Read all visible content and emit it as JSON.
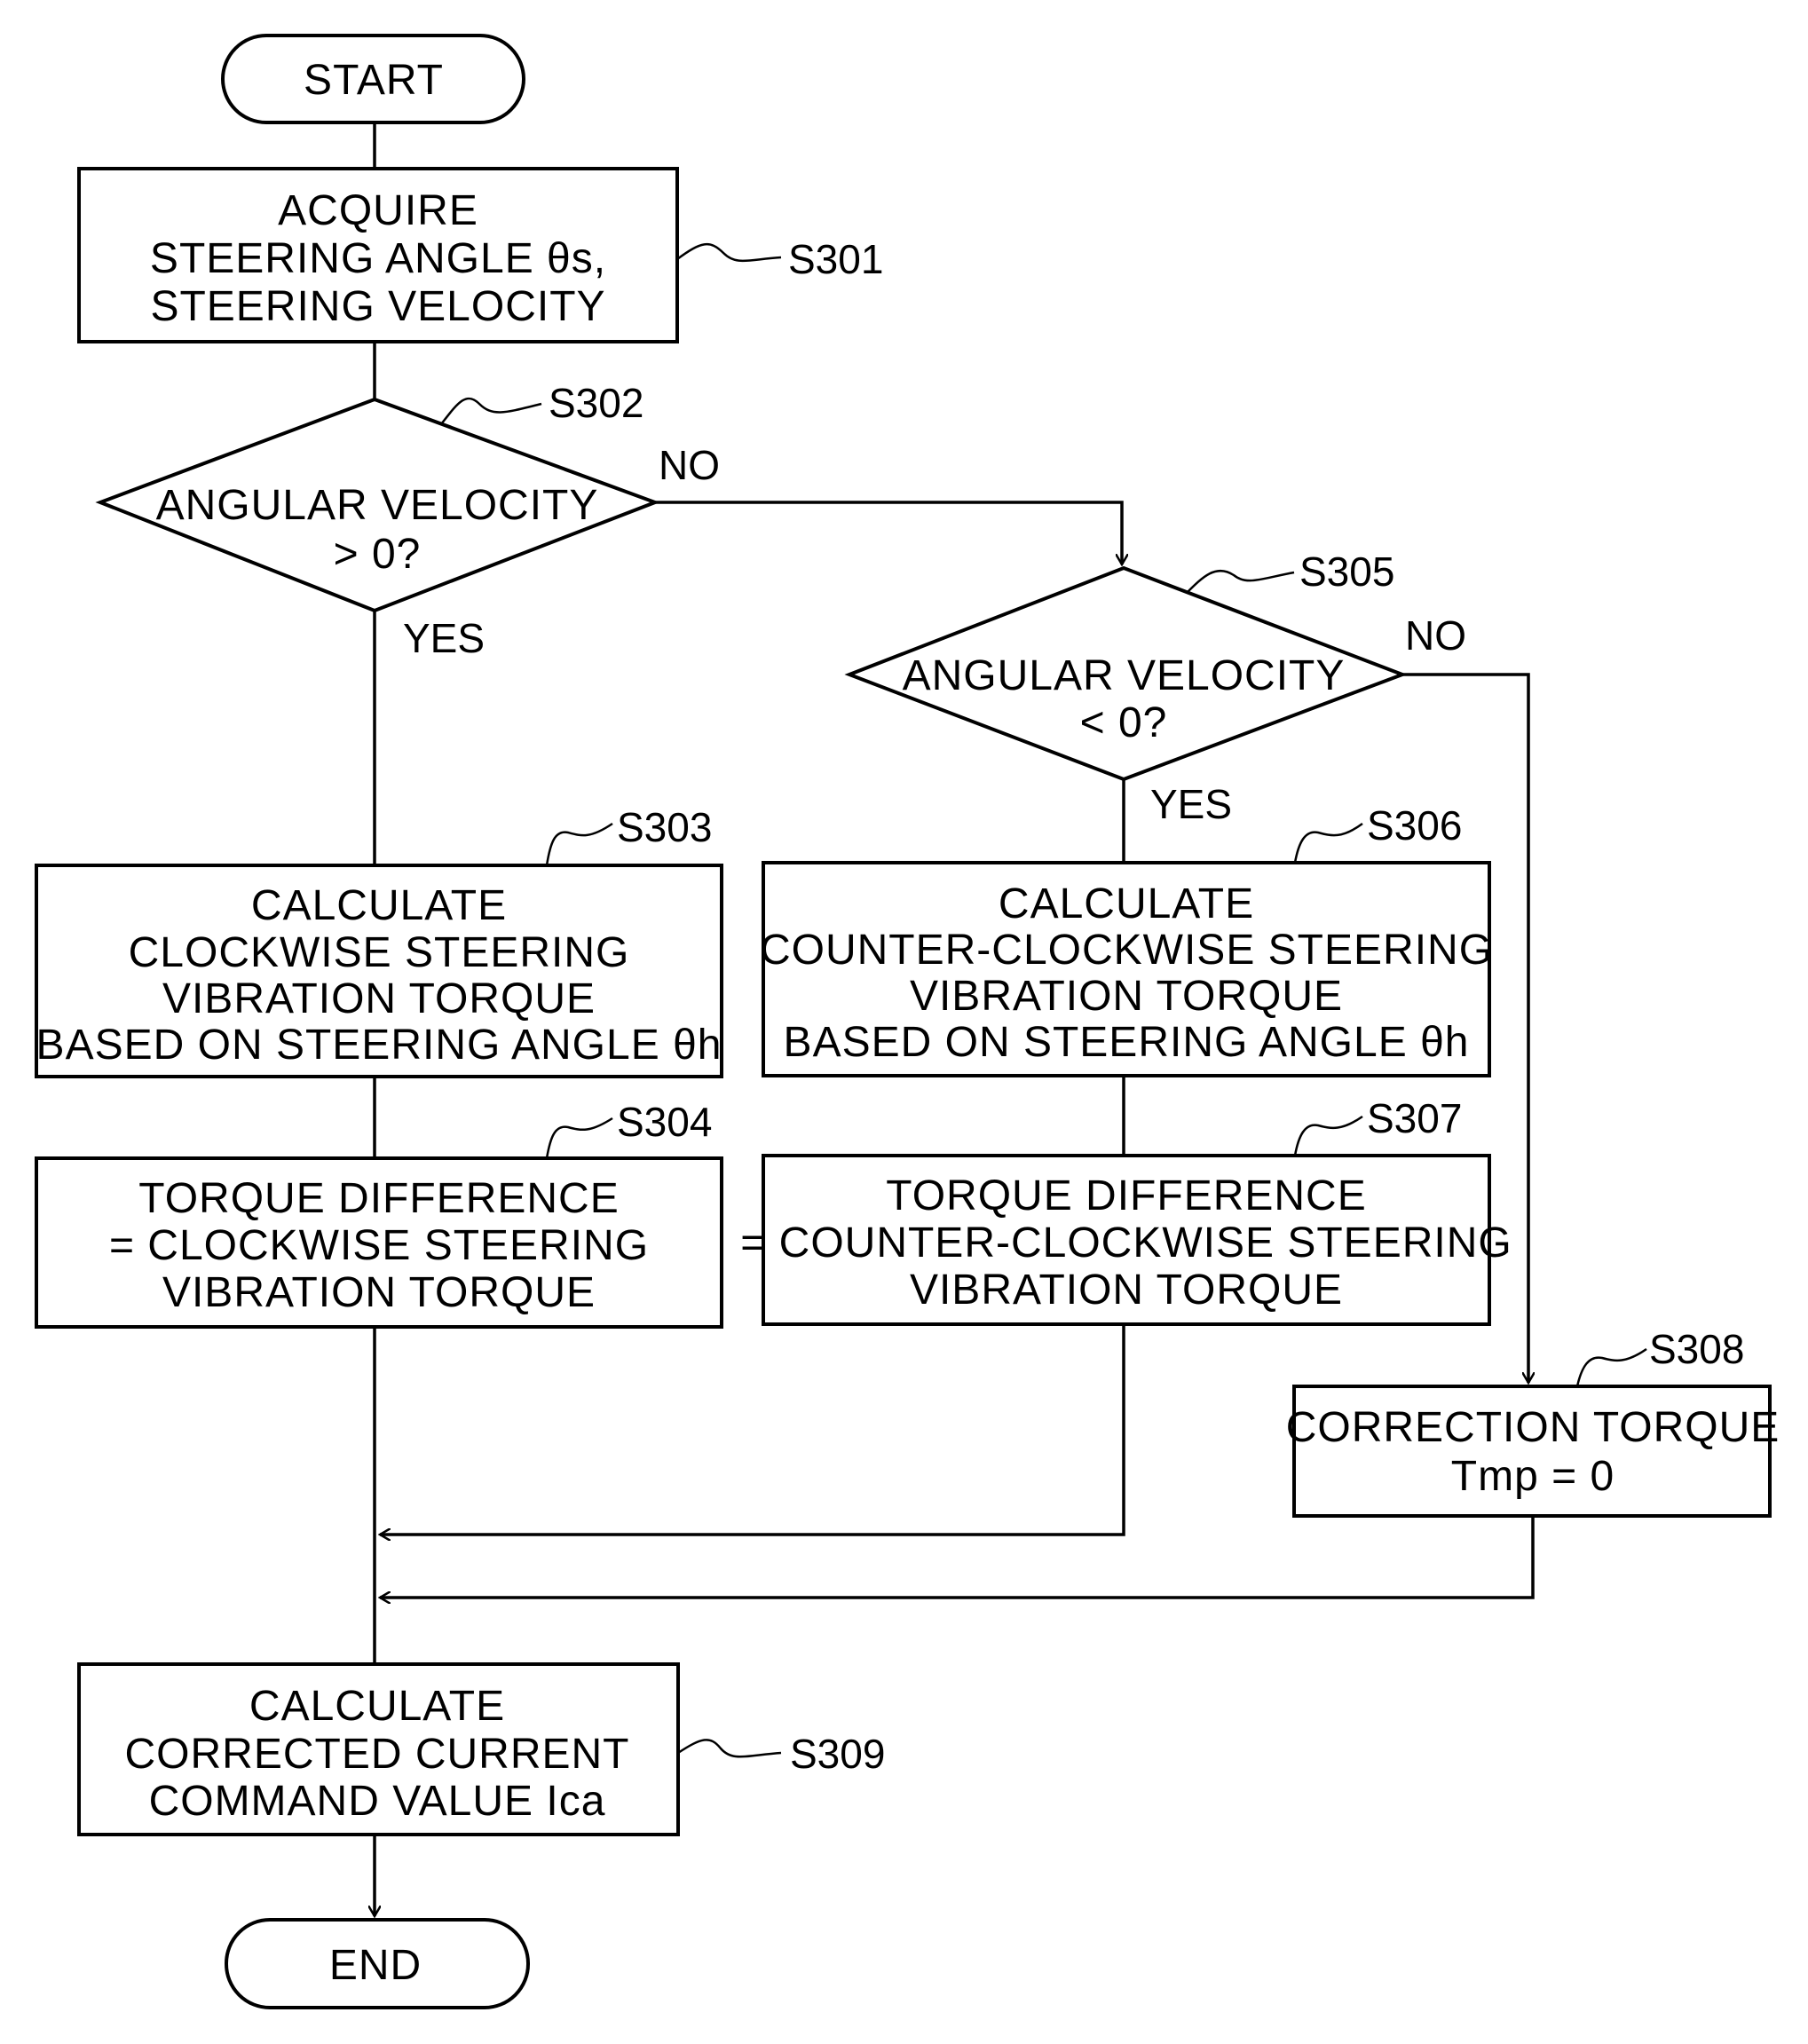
{
  "nodes": {
    "start": {
      "label": "START"
    },
    "s301": {
      "step": "S301",
      "lines": [
        "ACQUIRE",
        "STEERING ANGLE θs,",
        "STEERING VELOCITY"
      ]
    },
    "s302": {
      "step": "S302",
      "lines": [
        "ANGULAR VELOCITY",
        "> 0?"
      ],
      "yes": "YES",
      "no": "NO"
    },
    "s303": {
      "step": "S303",
      "lines": [
        "CALCULATE",
        "CLOCKWISE STEERING",
        "VIBRATION TORQUE",
        "BASED ON STEERING ANGLE θh"
      ]
    },
    "s304": {
      "step": "S304",
      "lines": [
        "TORQUE DIFFERENCE",
        "= CLOCKWISE STEERING",
        "VIBRATION TORQUE"
      ]
    },
    "s305": {
      "step": "S305",
      "lines": [
        "ANGULAR VELOCITY",
        "< 0?"
      ],
      "yes": "YES",
      "no": "NO"
    },
    "s306": {
      "step": "S306",
      "lines": [
        "CALCULATE",
        "COUNTER-CLOCKWISE STEERING",
        "VIBRATION TORQUE",
        "BASED ON STEERING ANGLE θh"
      ]
    },
    "s307": {
      "step": "S307",
      "lines": [
        "TORQUE DIFFERENCE",
        "= COUNTER-CLOCKWISE STEERING",
        "VIBRATION TORQUE"
      ]
    },
    "s308": {
      "step": "S308",
      "lines": [
        "CORRECTION TORQUE",
        "Tmp = 0"
      ]
    },
    "s309": {
      "step": "S309",
      "lines": [
        "CALCULATE",
        "CORRECTED CURRENT",
        "COMMAND VALUE Ica"
      ]
    },
    "end": {
      "label": "END"
    }
  }
}
